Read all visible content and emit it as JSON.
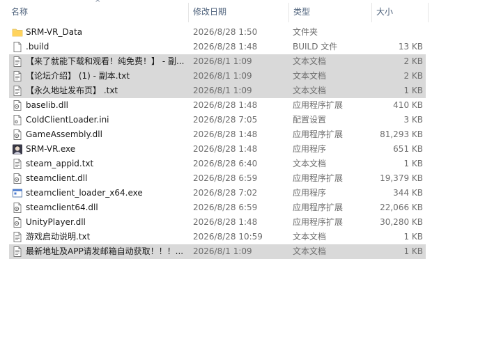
{
  "header": {
    "name": "名称",
    "date": "修改日期",
    "type": "类型",
    "size": "大小",
    "sort_indicator": "^"
  },
  "files": [
    {
      "name": "SRM-VR_Data",
      "date": "2026/8/28 1:50",
      "type": "文件夹",
      "size": "",
      "icon": "folder-icon",
      "selected": false
    },
    {
      "name": ".build",
      "date": "2026/8/28 1:48",
      "type": "BUILD 文件",
      "size": "13 KB",
      "icon": "file-icon",
      "selected": false
    },
    {
      "name": "【来了就能下载和观看！纯免费！】 - 副...",
      "date": "2026/8/1 1:09",
      "type": "文本文档",
      "size": "2 KB",
      "icon": "text-file-icon",
      "selected": true
    },
    {
      "name": "【论坛介绍】 (1) - 副本.txt",
      "date": "2026/8/1 1:09",
      "type": "文本文档",
      "size": "2 KB",
      "icon": "text-file-icon",
      "selected": true
    },
    {
      "name": "【永久地址发布页】 .txt",
      "date": "2026/8/1 1:09",
      "type": "文本文档",
      "size": "1 KB",
      "icon": "text-file-icon",
      "selected": true
    },
    {
      "name": "baselib.dll",
      "date": "2026/8/28 1:48",
      "type": "应用程序扩展",
      "size": "410 KB",
      "icon": "dll-file-icon",
      "selected": false
    },
    {
      "name": "ColdClientLoader.ini",
      "date": "2026/8/28 7:05",
      "type": "配置设置",
      "size": "3 KB",
      "icon": "settings-file-icon",
      "selected": false
    },
    {
      "name": "GameAssembly.dll",
      "date": "2026/8/28 1:48",
      "type": "应用程序扩展",
      "size": "81,293 KB",
      "icon": "dll-file-icon",
      "selected": false
    },
    {
      "name": "SRM-VR.exe",
      "date": "2026/8/28 1:48",
      "type": "应用程序",
      "size": "651 KB",
      "icon": "game-app-icon",
      "selected": false
    },
    {
      "name": "steam_appid.txt",
      "date": "2026/8/28 6:40",
      "type": "文本文档",
      "size": "1 KB",
      "icon": "text-file-icon",
      "selected": false
    },
    {
      "name": "steamclient.dll",
      "date": "2026/8/28 6:59",
      "type": "应用程序扩展",
      "size": "19,379 KB",
      "icon": "dll-file-icon",
      "selected": false
    },
    {
      "name": "steamclient_loader_x64.exe",
      "date": "2026/8/28 7:02",
      "type": "应用程序",
      "size": "344 KB",
      "icon": "exe-window-icon",
      "selected": false
    },
    {
      "name": "steamclient64.dll",
      "date": "2026/8/28 6:59",
      "type": "应用程序扩展",
      "size": "22,066 KB",
      "icon": "dll-file-icon",
      "selected": false
    },
    {
      "name": "UnityPlayer.dll",
      "date": "2026/8/28 1:48",
      "type": "应用程序扩展",
      "size": "30,280 KB",
      "icon": "dll-file-icon",
      "selected": false
    },
    {
      "name": "游戏启动说明.txt",
      "date": "2026/8/28 10:59",
      "type": "文本文档",
      "size": "1 KB",
      "icon": "text-file-icon",
      "selected": false
    },
    {
      "name": "最新地址及APP请发邮箱自动获取！！！...",
      "date": "2026/8/1 1:09",
      "type": "文本文档",
      "size": "1 KB",
      "icon": "text-file-icon",
      "selected": true
    }
  ]
}
